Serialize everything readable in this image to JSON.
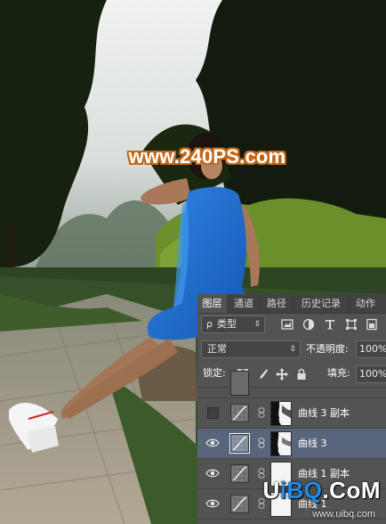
{
  "watermark": {
    "site": "www.240PS.com"
  },
  "panel": {
    "tabs": [
      "图层",
      "通道",
      "路径",
      "历史记录",
      "动作"
    ],
    "active_tab": "图层",
    "filter": {
      "search_glyph": "ρ",
      "kind_label": "类型"
    },
    "blend_mode": "正常",
    "opacity_label": "不透明度:",
    "opacity_value": "100%",
    "lock_label": "锁定:",
    "fill_label": "填充:",
    "fill_value": "100%",
    "layers": [
      {
        "name": "曲线 3 副本",
        "visible": false,
        "selected": false
      },
      {
        "name": "曲线 3",
        "visible": true,
        "selected": true
      },
      {
        "name": "曲线 1 副本",
        "visible": true,
        "selected": false
      },
      {
        "name": "曲线 1",
        "visible": true,
        "selected": false
      }
    ]
  },
  "site_logo": {
    "u": "U",
    "ibq": "iBQ",
    "com": ".CoM",
    "sub": "www.uibq.com"
  },
  "colors": {
    "panel_bg": "#535353",
    "selected_row": "#59657a",
    "watermark_outline": "#c4691a",
    "logo_accent": "#1f8ce8"
  }
}
